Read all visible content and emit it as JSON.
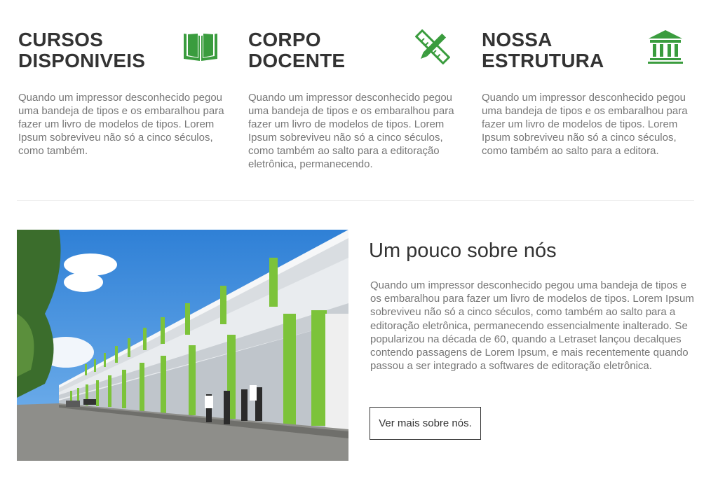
{
  "colors": {
    "accent": "#3a9c3e",
    "heading": "#333333",
    "text": "#777777"
  },
  "features": [
    {
      "title_line1": "CURSOS",
      "title_line2": "DISPONIVEIS",
      "icon": "open-book-icon",
      "text": "Quando um impressor desconhecido pegou uma bandeja de tipos e os embaralhou para fazer um livro de modelos de tipos. Lorem Ipsum sobreviveu não só a cinco séculos, como também."
    },
    {
      "title_line1": "CORPO",
      "title_line2": "DOCENTE",
      "icon": "pencil-ruler-icon",
      "text": "Quando um impressor desconhecido pegou uma bandeja de tipos e os embaralhou para fazer um livro de modelos de tipos. Lorem Ipsum sobreviveu não só a cinco séculos, como também ao salto para a editoração eletrônica, permanecendo."
    },
    {
      "title_line1": "NOSSA",
      "title_line2": "ESTRUTURA",
      "icon": "institution-icon",
      "text": "Quando um impressor desconhecido pegou uma bandeja de tipos e os embaralhou para fazer um livro de modelos de tipos. Lorem Ipsum sobreviveu não só a cinco séculos, como também ao salto para a editora."
    }
  ],
  "about": {
    "title": "Um pouco sobre nós",
    "text": "Quando um impressor desconhecido pegou uma bandeja de tipos e os embaralhou para fazer um livro de modelos de tipos. Lorem Ipsum sobreviveu não só a cinco séculos, como também ao salto para a editoração eletrônica, permanecendo essencialmente inalterado. Se popularizou na década de 60, quando a Letraset lançou decalques contendo passagens de Lorem Ipsum, e mais recentemente quando passou a ser integrado a softwares de editoração eletrônica.",
    "button_label": "Ver mais sobre nós."
  }
}
